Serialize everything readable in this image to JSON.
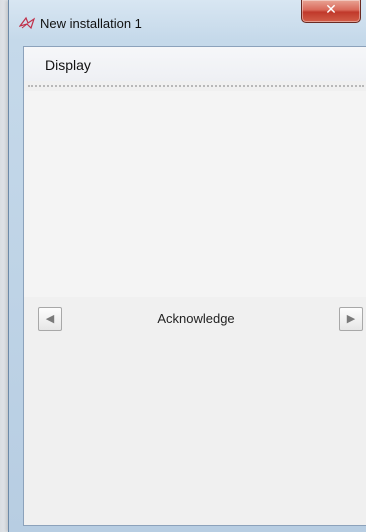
{
  "window": {
    "title": "New installation 1",
    "close_label": "✕",
    "app_icon": "installation-logo-icon"
  },
  "menu": {
    "items": [
      {
        "label": "Display"
      }
    ]
  },
  "navigation": {
    "prev_icon": "triangle-left-icon",
    "next_icon": "triangle-right-icon",
    "prev_glyph": "◀",
    "next_glyph": "▶",
    "label": "Acknowledge"
  },
  "colors": {
    "close_button": "#c0392b",
    "window_frame": "#c5d9ea",
    "client_background": "#f0f0f0"
  }
}
